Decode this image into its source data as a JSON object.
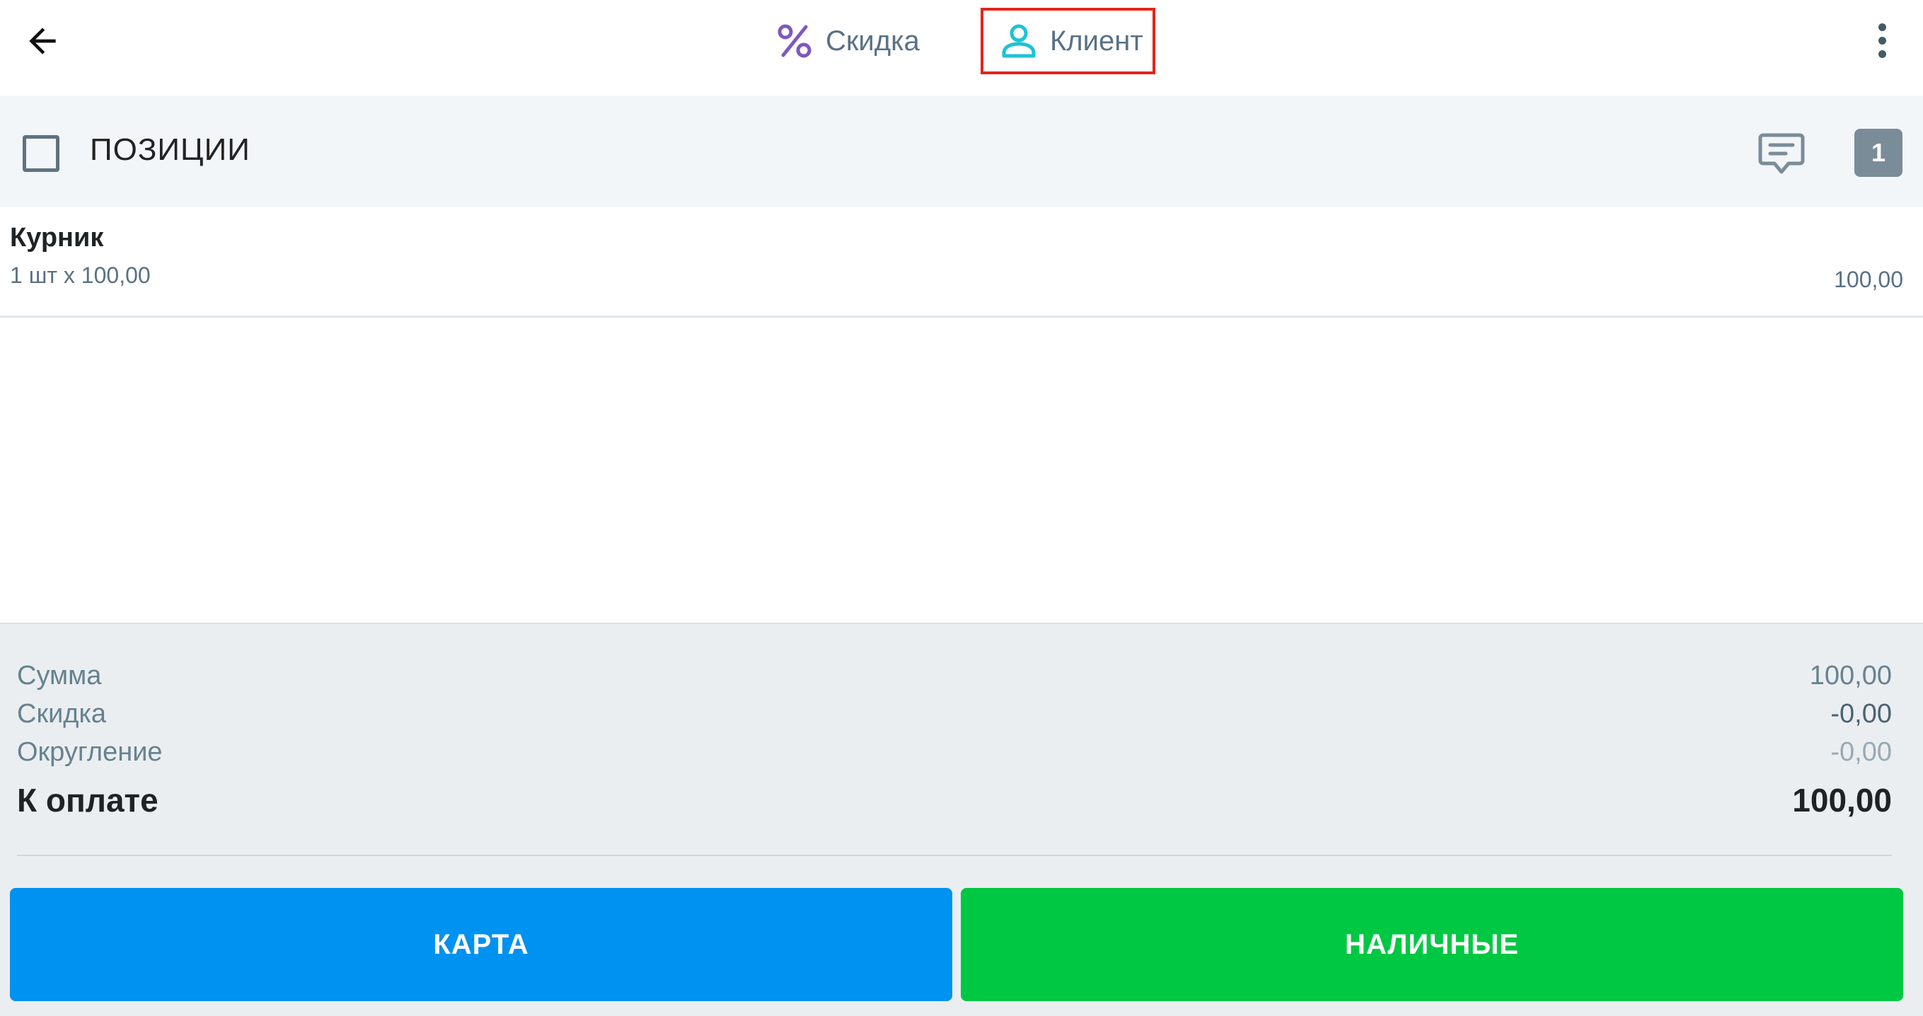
{
  "topbar": {
    "tabs": [
      {
        "label": "Скидка",
        "icon": "percent-icon",
        "color": "#7e57c2"
      },
      {
        "label": "Клиент",
        "icon": "person-icon",
        "color": "#1cc3d6"
      }
    ]
  },
  "positions": {
    "label": "ПОЗИЦИИ",
    "count": "1"
  },
  "items": [
    {
      "name": "Курник",
      "qty": "1 шт х 100,00",
      "total": "100,00"
    }
  ],
  "summary": {
    "sum_label": "Сумма",
    "sum_value": "100,00",
    "discount_label": "Скидка",
    "discount_value": "-0,00",
    "rounding_label": "Округление",
    "rounding_value": "-0,00",
    "total_label": "К оплате",
    "total_value": "100,00"
  },
  "buttons": {
    "card": "КАРТА",
    "cash": "НАЛИЧНЫЕ"
  },
  "colors": {
    "card_button": "#0092f0",
    "cash_button": "#00c843",
    "highlight_box": "#e3241b"
  }
}
